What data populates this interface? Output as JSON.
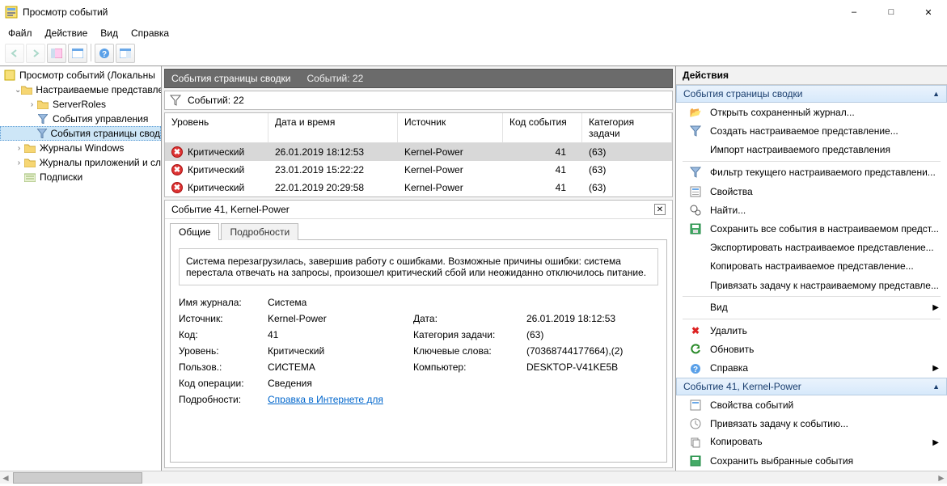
{
  "window": {
    "title": "Просмотр событий",
    "menu": {
      "file": "Файл",
      "action": "Действие",
      "view": "Вид",
      "help": "Справка"
    }
  },
  "tree": {
    "root": "Просмотр событий (Локальны",
    "custom_views": "Настраиваемые представле",
    "server_roles": "ServerRoles",
    "admin_events": "События управления",
    "summary_events": "События страницы свод",
    "windows_logs": "Журналы Windows",
    "app_logs": "Журналы приложений и сл",
    "subscriptions": "Подписки"
  },
  "mid": {
    "header_title": "События страницы сводки",
    "header_count": "Событий: 22",
    "filter_count": "Событий: 22",
    "columns": {
      "c1": "Уровень",
      "c2": "Дата и время",
      "c3": "Источник",
      "c4": "Код события",
      "c5": "Категория задачи"
    },
    "rows": [
      {
        "level": "Критический",
        "date": "26.01.2019 18:12:53",
        "source": "Kernel-Power",
        "code": "41",
        "cat": "(63)",
        "sel": true
      },
      {
        "level": "Критический",
        "date": "23.01.2019 15:22:22",
        "source": "Kernel-Power",
        "code": "41",
        "cat": "(63)",
        "sel": false
      },
      {
        "level": "Критический",
        "date": "22.01.2019 20:29:58",
        "source": "Kernel-Power",
        "code": "41",
        "cat": "(63)",
        "sel": false
      }
    ]
  },
  "detail": {
    "title": "Событие 41, Kernel-Power",
    "tabs": {
      "general": "Общие",
      "details": "Подробности"
    },
    "description": "Система перезагрузилась, завершив работу с ошибками. Возможные причины ошибки: система перестала отвечать на запросы, произошел критический сбой или неожиданно отключилось питание.",
    "labels": {
      "log": "Имя журнала:",
      "source": "Источник:",
      "code": "Код:",
      "level": "Уровень:",
      "user": "Пользов.:",
      "opcode": "Код операции:",
      "more": "Подробности:",
      "date": "Дата:",
      "cat": "Категория задачи:",
      "keywords": "Ключевые слова:",
      "computer": "Компьютер:"
    },
    "values": {
      "log": "Система",
      "source": "Kernel-Power",
      "code": "41",
      "level": "Критический",
      "user": "СИСТЕМА",
      "opcode": "Сведения",
      "date": "26.01.2019 18:12:53",
      "cat": "(63)",
      "keywords": "(70368744177664),(2)",
      "computer": "DESKTOP-V41KE5B",
      "more_link": "Справка в Интернете для"
    }
  },
  "actions": {
    "pane_title": "Действия",
    "section1_title": "События страницы сводки",
    "items1": {
      "open_saved": "Открыть сохраненный журнал...",
      "create_view": "Создать настраиваемое представление...",
      "import_view": "Импорт настраиваемого представления",
      "filter": "Фильтр текущего настраиваемого представлени...",
      "props": "Свойства",
      "find": "Найти...",
      "save_all": "Сохранить все события в настраиваемом предст...",
      "export": "Экспортировать настраиваемое представление...",
      "copy": "Копировать настраиваемое представление...",
      "attach": "Привязать задачу к настраиваемому представле...",
      "view": "Вид",
      "delete": "Удалить",
      "refresh": "Обновить",
      "help": "Справка"
    },
    "section2_title": "Событие 41, Kernel-Power",
    "items2": {
      "ev_props": "Свойства событий",
      "ev_attach": "Привязать задачу к событию...",
      "ev_copy": "Копировать",
      "ev_save": "Сохранить выбранные события"
    }
  }
}
